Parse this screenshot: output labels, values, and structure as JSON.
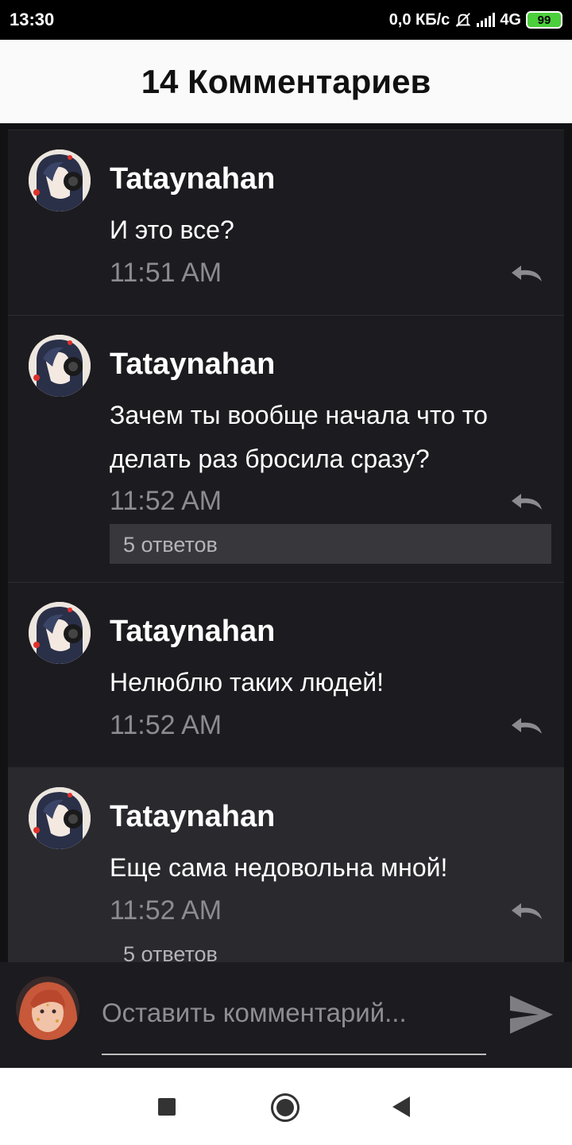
{
  "status_bar": {
    "time": "13:30",
    "network_speed": "0,0 КБ/с",
    "network_type": "4G",
    "battery": "99",
    "icons": [
      "bell-off-icon",
      "signal-icon",
      "battery-icon"
    ]
  },
  "header": {
    "title": "14 Комментариев"
  },
  "comments": [
    {
      "author": "Tataynahan",
      "text": "И это все?",
      "time": "11:51 AM",
      "replies": ""
    },
    {
      "author": "Tataynahan",
      "text": "Зачем ты вообще начала что то делать раз бросила сразу?",
      "time": "11:52 AM",
      "replies": "5 ответов"
    },
    {
      "author": "Tataynahan",
      "text": "Нелюблю таких людей!",
      "time": "11:52 AM",
      "replies": ""
    },
    {
      "author": "Tataynahan",
      "text": "Еще сама недовольна мной!",
      "time": "11:52 AM",
      "replies": "5 ответов"
    }
  ],
  "input": {
    "placeholder": "Оставить комментарий..."
  },
  "colors": {
    "header_bg": "#fafafa",
    "list_bg": "#1c1b1f",
    "highlight_bg": "#2a292e",
    "timestamp": "#8c8c90",
    "battery_fill": "#4ccf3c"
  }
}
